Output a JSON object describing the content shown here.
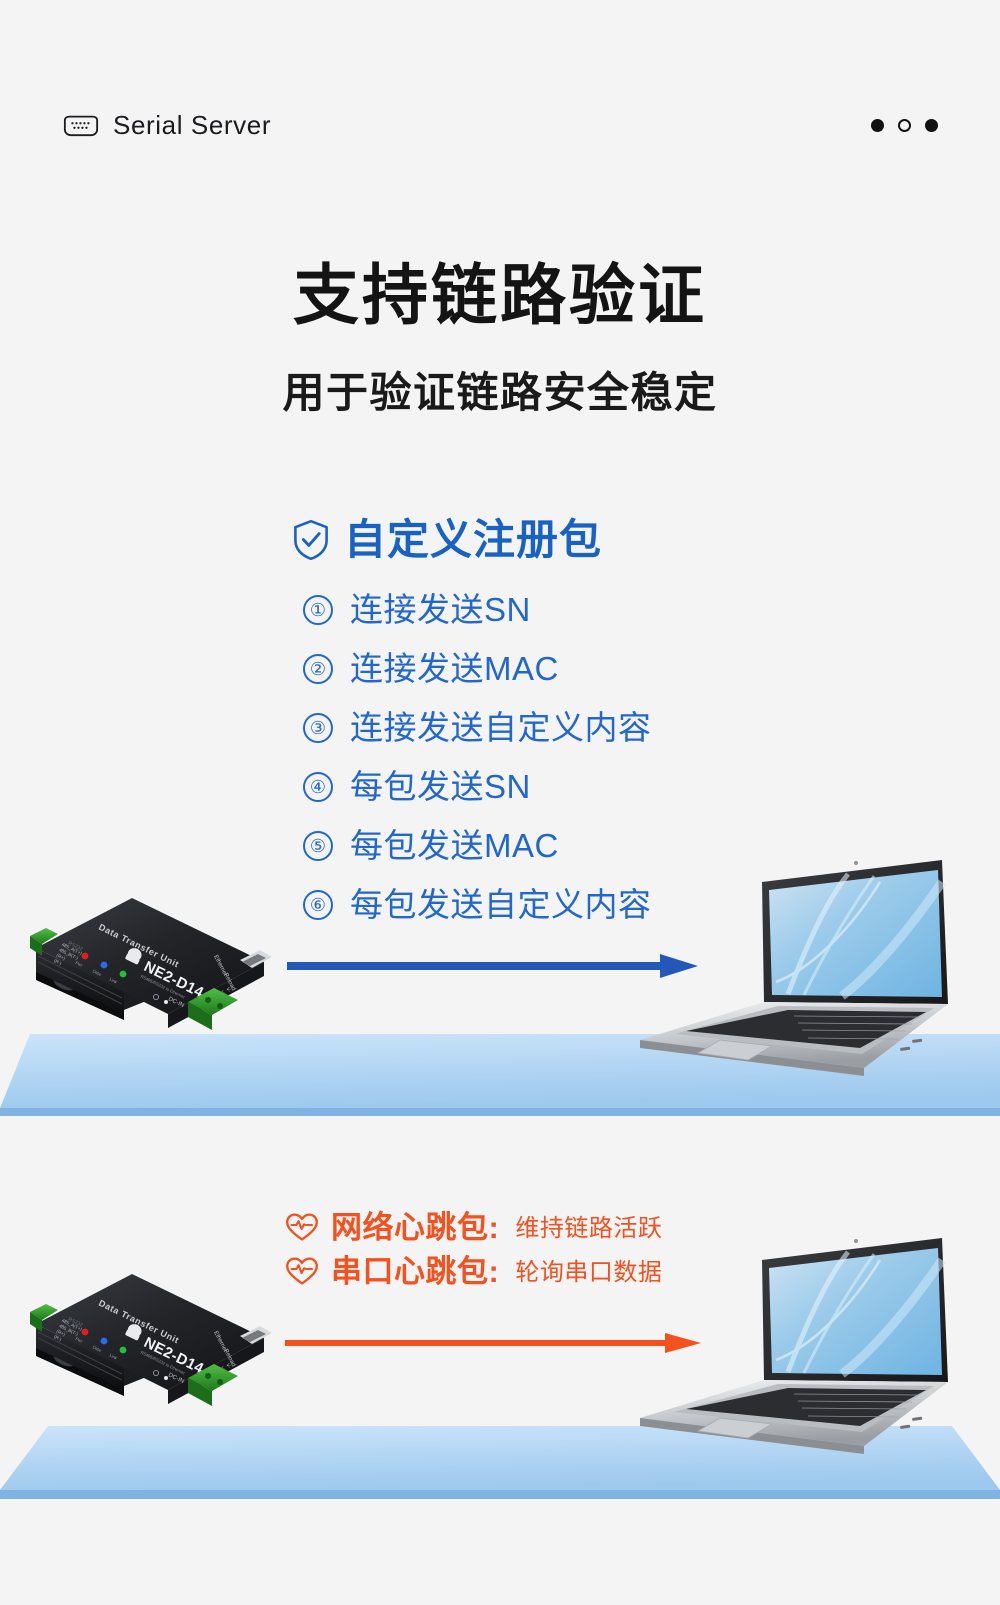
{
  "header": {
    "brand_name": "Serial Server",
    "brand_icon": "db9-serial-connector-icon",
    "dots": [
      "filled",
      "hollow",
      "filled"
    ]
  },
  "title": {
    "main": "支持链路验证",
    "sub": "用于验证链路安全稳定"
  },
  "register": {
    "icon": "shield-check-icon",
    "heading": "自定义注册包",
    "items": [
      {
        "num": "①",
        "label": "连接发送SN"
      },
      {
        "num": "②",
        "label": "连接发送MAC"
      },
      {
        "num": "③",
        "label": "连接发送自定义内容"
      },
      {
        "num": "④",
        "label": "每包发送SN"
      },
      {
        "num": "⑤",
        "label": "每包发送MAC"
      },
      {
        "num": "⑥",
        "label": "每包发送自定义内容"
      }
    ]
  },
  "heartbeat": {
    "rows": [
      {
        "icon": "heart-pulse-icon",
        "title": "网络心跳包:",
        "desc": "维持链路活跃"
      },
      {
        "icon": "heart-pulse-icon",
        "title": "串口心跳包:",
        "desc": "轮询串口数据"
      }
    ]
  },
  "device": {
    "model": "NE2-D14",
    "top_label": "Data Transfer Unit",
    "side_label": "RS232",
    "port_labels": [
      "Ethernet",
      "Reload",
      "DC-IN",
      "V-",
      "V+"
    ],
    "terminal_labels": [
      "485_A(T+)",
      "485_B(T-)",
      "(R+)",
      "(R-)"
    ],
    "led_labels": [
      "Pwr",
      "Data",
      "Link"
    ],
    "led_colors": [
      "#e02020",
      "#2a6cf0",
      "#22c03a"
    ]
  },
  "colors": {
    "background": "#f4f4f4",
    "blue_accent": "#2167cf",
    "blue_heading": "#1862c6",
    "orange_accent": "#f4511e",
    "slab_light": "#cfe6f8",
    "slab_dark": "#7eb3e0",
    "text_dark": "#141414"
  }
}
